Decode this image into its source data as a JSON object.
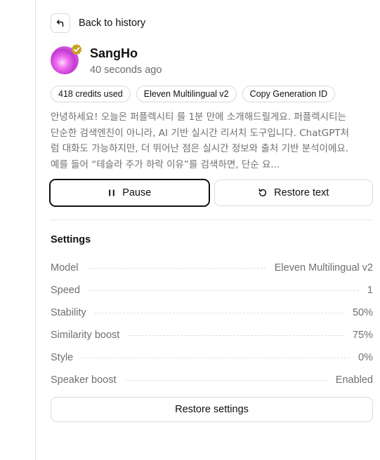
{
  "nav": {
    "back_label": "Back to history",
    "back_icon": "arrow-return-left-icon"
  },
  "profile": {
    "name": "SangHo",
    "timestamp": "40 seconds ago",
    "verified_color": "#c9a227"
  },
  "chips": [
    "418 credits used",
    "Eleven Multilingual v2",
    "Copy Generation ID"
  ],
  "text": {
    "body": "안녕하세요! 오늘은 퍼플렉시티 를 1분 만에 소개해드릴게요. 퍼플렉시티는 단순한 검색엔진이 아니라, AI 기반 실시간 리서치 도구입니다. ChatGPT처럼 대화도 가능하지만, 더 뛰어난 점은 실시간 정보와 출처 기반 분석이에요. 예를 들어 “테슬라 주가 하락 이유”를 검색하면, 단순 요..."
  },
  "actions": {
    "pause_label": "Pause",
    "restore_text_label": "Restore text"
  },
  "settings": {
    "title": "Settings",
    "rows": [
      {
        "label": "Model",
        "value": "Eleven Multilingual v2"
      },
      {
        "label": "Speed",
        "value": "1"
      },
      {
        "label": "Stability",
        "value": "50%"
      },
      {
        "label": "Similarity boost",
        "value": "75%"
      },
      {
        "label": "Style",
        "value": "0%"
      },
      {
        "label": "Speaker boost",
        "value": "Enabled"
      }
    ],
    "restore_label": "Restore settings"
  }
}
